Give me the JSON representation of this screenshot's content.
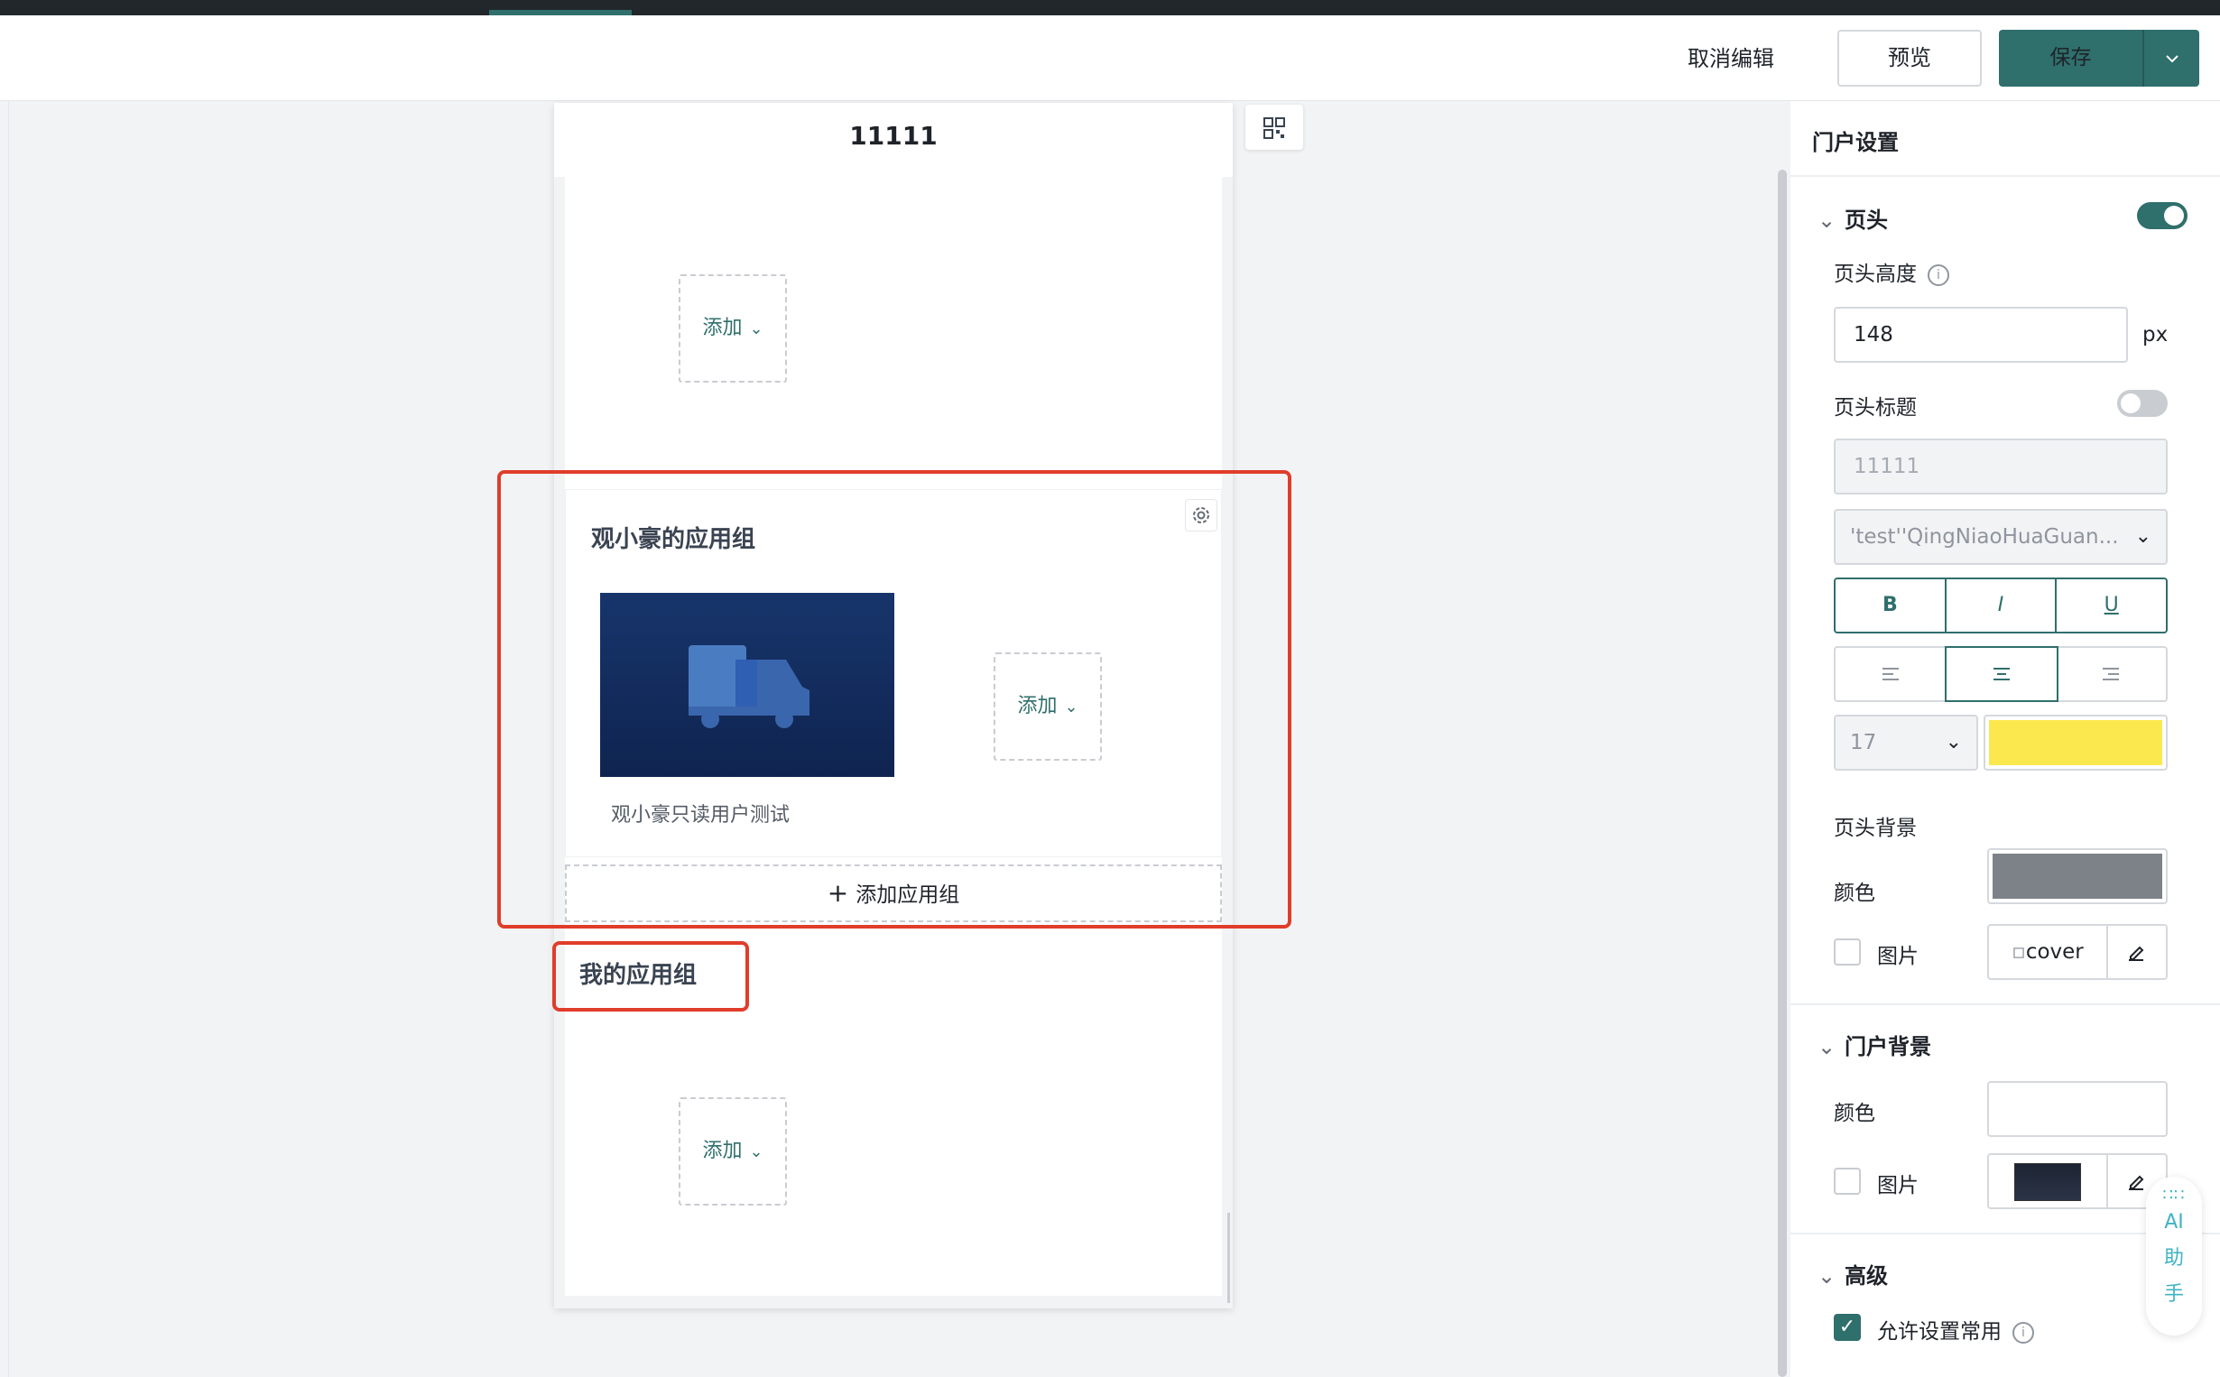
{
  "toolbar": {
    "cancel_label": "取消编辑",
    "preview_label": "预览",
    "save_label": "保存"
  },
  "phone": {
    "title": "11111",
    "add_label": "添加",
    "group": {
      "title": "观小豪的应用组",
      "app_name": "观小豪只读用户测试"
    },
    "add_group_label": "添加应用组",
    "my_group_title": "我的应用组"
  },
  "panel": {
    "title": "门户设置",
    "header_section": {
      "label": "页头",
      "enabled": true,
      "height_label": "页头高度",
      "height_value": "148",
      "height_unit": "px",
      "title_label": "页头标题",
      "title_enabled": false,
      "title_value": "11111",
      "font_family": "'test''QingNiaoHuaGuan...",
      "font_styles": [
        "B",
        "I",
        "U"
      ],
      "align_options": [
        "left",
        "center",
        "right"
      ],
      "align_selected": "center",
      "font_size": "17",
      "font_color": "#fbe84f",
      "bg_label": "页头背景",
      "color_label": "颜色",
      "bg_color": "#7c8287",
      "image_label": "图片",
      "image_alt": "cover"
    },
    "portal_bg": {
      "label": "门户背景",
      "color_label": "颜色",
      "image_label": "图片"
    },
    "advanced": {
      "label": "高级",
      "allow_common_label": "允许设置常用",
      "allow_common_checked": true
    }
  },
  "ai_assistant": {
    "line1": "AI",
    "line2": "助",
    "line3": "手"
  }
}
